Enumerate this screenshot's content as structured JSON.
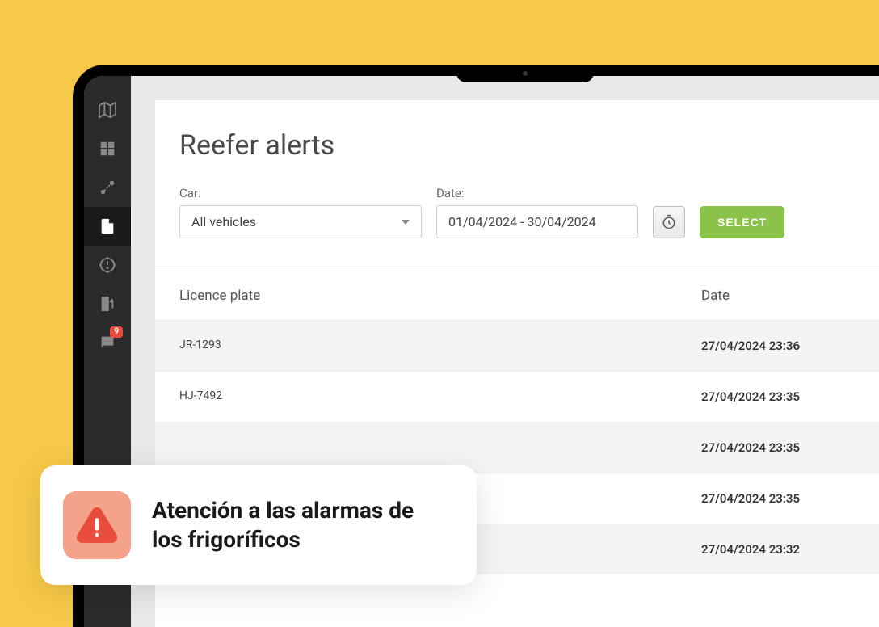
{
  "sidebar": {
    "items": [
      {
        "name": "map"
      },
      {
        "name": "dashboard"
      },
      {
        "name": "routes"
      },
      {
        "name": "documents"
      },
      {
        "name": "alerts"
      },
      {
        "name": "fuel"
      },
      {
        "name": "messages"
      }
    ],
    "badge": "9"
  },
  "page": {
    "title": "Reefer alerts"
  },
  "filters": {
    "car_label": "Car:",
    "car_value": "All vehicles",
    "date_label": "Date:",
    "date_value": "01/04/2024 - 30/04/2024",
    "select_button": "SELECT"
  },
  "table": {
    "headers": {
      "plate": "Licence plate",
      "date": "Date"
    },
    "rows": [
      {
        "plate": "JR-1293",
        "date": "27/04/2024 23:36"
      },
      {
        "plate": "HJ-7492",
        "date": "27/04/2024 23:35"
      },
      {
        "plate": "",
        "date": "27/04/2024 23:35"
      },
      {
        "plate": "",
        "date": "27/04/2024 23:35"
      },
      {
        "plate": "",
        "date": "27/04/2024 23:32"
      }
    ]
  },
  "overlay": {
    "text": "Atención a las alarmas de los frigoríficos"
  }
}
